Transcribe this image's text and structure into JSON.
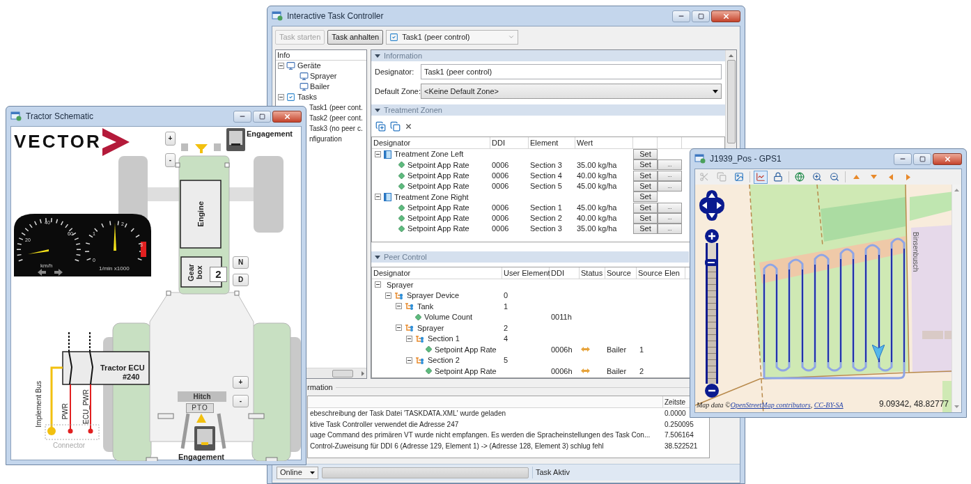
{
  "task_controller": {
    "title": "Interactive Task Controller",
    "toolbar": {
      "buttons": [
        {
          "label": "Task starten",
          "disabled": true
        },
        {
          "label": "Task anhalten",
          "disabled": false
        }
      ],
      "task_select": {
        "value": "Task1 (peer control)",
        "checked": true
      }
    },
    "tree": {
      "header": "Info",
      "items": [
        {
          "label": "Geräte",
          "kind": "group",
          "expanded": true,
          "children": [
            {
              "label": "Sprayer",
              "kind": "device"
            },
            {
              "label": "Bailer",
              "kind": "device"
            }
          ]
        },
        {
          "label": "Tasks",
          "kind": "tasks",
          "expanded": true,
          "children": [
            {
              "label": "Task1 (peer cont.",
              "kind": "task"
            },
            {
              "label": "Task2 (peer cont.",
              "kind": "task"
            },
            {
              "label": "Task3 (no peer c.",
              "kind": "task"
            }
          ]
        },
        {
          "label": "nfiguration",
          "kind": "setting"
        }
      ]
    },
    "information": {
      "header": "Information",
      "expanded": true,
      "designator_label": "Designator:",
      "designator": "Task1 (peer control)",
      "zone_label": "Default Zone:",
      "zone": "<Keine Default Zone>"
    },
    "treatment_zones": {
      "header": "Treatment Zonen",
      "expanded": true,
      "columns": [
        "Designator",
        "DDI",
        "Element",
        "Wert"
      ],
      "zones": [
        {
          "designator": "Treatment Zone Left",
          "expanded": true,
          "set": "Set",
          "rows": [
            {
              "designator": "Setpoint App Rate",
              "ddi": "0006",
              "element": "Section 3",
              "wert": "35.00 kg/ha",
              "set": "Set",
              "more": "..."
            },
            {
              "designator": "Setpoint App Rate",
              "ddi": "0006",
              "element": "Section 4",
              "wert": "40.00 kg/ha",
              "set": "Set",
              "more": "..."
            },
            {
              "designator": "Setpoint App Rate",
              "ddi": "0006",
              "element": "Section 5",
              "wert": "45.00 kg/ha",
              "set": "Set",
              "more": "..."
            }
          ]
        },
        {
          "designator": "Treatment Zone Right",
          "expanded": true,
          "set": "Set",
          "rows": [
            {
              "designator": "Setpoint App Rate",
              "ddi": "0006",
              "element": "Section 1",
              "wert": "45.00 kg/ha",
              "set": "Set",
              "more": "..."
            },
            {
              "designator": "Setpoint App Rate",
              "ddi": "0006",
              "element": "Section 2",
              "wert": "40.00 kg/ha",
              "set": "Set",
              "more": "..."
            },
            {
              "designator": "Setpoint App Rate",
              "ddi": "0006",
              "element": "Section 3",
              "wert": "35.00 kg/ha",
              "set": "Set",
              "more": "..."
            }
          ]
        }
      ]
    },
    "peer_control": {
      "header": "Peer Control",
      "expanded": true,
      "columns": [
        "Designator",
        "User Element",
        "DDI",
        "Status",
        "Source",
        "Source Elen"
      ],
      "rows": [
        {
          "designator": "Sprayer",
          "kind": "device",
          "expanded": true,
          "children": [
            {
              "designator": "Sprayer Device",
              "kind": "element",
              "user_element": "0",
              "expanded": true,
              "children": [
                {
                  "designator": "Tank",
                  "kind": "element",
                  "user_element": "1",
                  "expanded": true,
                  "children": [
                    {
                      "designator": "Volume Count",
                      "kind": "value",
                      "ddi": "0011h"
                    }
                  ]
                },
                {
                  "designator": "Sprayer",
                  "kind": "element",
                  "user_element": "2",
                  "expanded": true,
                  "children": [
                    {
                      "designator": "Section 1",
                      "kind": "element",
                      "user_element": "4",
                      "expanded": true,
                      "children": [
                        {
                          "designator": "Setpoint App Rate",
                          "kind": "value",
                          "ddi": "0006h",
                          "linked": true,
                          "source": "Bailer",
                          "source_element": "1"
                        }
                      ]
                    },
                    {
                      "designator": "Section 2",
                      "kind": "element",
                      "user_element": "5",
                      "expanded": true,
                      "children": [
                        {
                          "designator": "Setpoint App Rate",
                          "kind": "value",
                          "ddi": "0006h",
                          "linked": true,
                          "source": "Bailer",
                          "source_element": "2"
                        }
                      ]
                    }
                  ]
                }
              ]
            }
          ]
        }
      ]
    },
    "log": {
      "header": "rmation",
      "time_header": "Zeitste",
      "rows": [
        {
          "message": "ebeschreibung der Task Datei 'TASKDATA.XML' wurde geladen",
          "time": "0.0000"
        },
        {
          "message": "ktive Task Controller verwendet die Adresse 247",
          "time": "0.250095"
        },
        {
          "message": "uage Command des primären VT wurde nicht empfangen. Es werden die Spracheinstellungen des Task Con...",
          "time": "7.506164"
        },
        {
          "message": "Control-Zuweisung für DDI 6 (Adresse 129, Element 1) -> (Adresse 128, Element 3) schlug fehl",
          "time": "38.522521"
        }
      ]
    },
    "status_bar": {
      "mode": "Online",
      "status": "Task Aktiv"
    }
  },
  "tractor": {
    "title": "Tractor Schematic",
    "logo": "VECTOR",
    "engagement_front": "Engagement",
    "front_hitch_buttons": [
      "+",
      "-"
    ],
    "engine": "Engine",
    "gearbox": "Gear box",
    "gear": "2",
    "gear_buttons": [
      "N",
      "D"
    ],
    "gauges": {
      "speed_labels": [
        "20",
        "40",
        "60"
      ],
      "speed_unit": "km/h",
      "rpm_labels": [
        "1",
        "2",
        "3",
        "0"
      ],
      "rpm_unit": "1/min x1000"
    },
    "ecu": {
      "name": "Tractor ECU",
      "address": "#240"
    },
    "wires": [
      "Implement Bus",
      "PWR",
      "ECU_PWR"
    ],
    "connector": "Connector",
    "hitch": "Hitch",
    "pto": "PTO",
    "rear_hitch_buttons": [
      "+",
      "-"
    ],
    "engagement_rear": "Engagement"
  },
  "gps": {
    "title": "J1939_Pos - GPS1",
    "tools": [
      {
        "disabled": true,
        "selected": false
      },
      {
        "disabled": true,
        "selected": false
      },
      {
        "disabled": false,
        "selected": false
      },
      {
        "disabled": false,
        "selected": true
      },
      {
        "disabled": false,
        "selected": false
      },
      {
        "disabled": false,
        "selected": false
      },
      {
        "disabled": false,
        "selected": false
      },
      {
        "disabled": false,
        "selected": false
      },
      {
        "disabled": false,
        "selected": false
      },
      {
        "disabled": false,
        "selected": false
      },
      {
        "disabled": false,
        "selected": false
      },
      {
        "disabled": false,
        "selected": false
      }
    ],
    "map": {
      "road_label": "Binsenbusch",
      "zoom": {
        "level": 0.88
      },
      "attribution": {
        "prefix": "Map data ©",
        "links": [
          "OpenStreetMap contributors",
          "CC-BY-SA"
        ],
        "separator": ", "
      },
      "coordinates": "9.09342, 48.82777"
    }
  }
}
